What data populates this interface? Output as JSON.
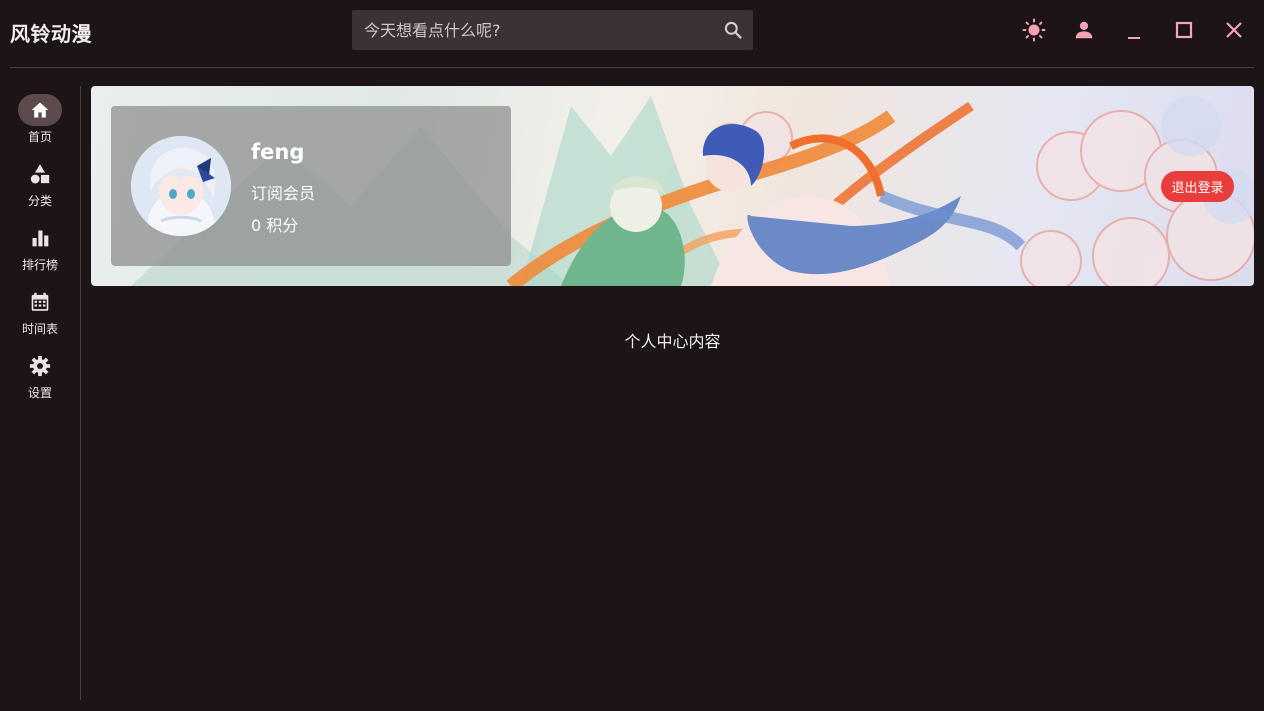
{
  "app": {
    "title": "风铃动漫"
  },
  "search": {
    "placeholder": "今天想看点什么呢?"
  },
  "window_controls": [
    "theme-toggle",
    "user",
    "minimize",
    "maximize",
    "close"
  ],
  "colors": {
    "background": "#1c1416",
    "accent_pink": "#f5a3b5",
    "logout_red": "#e83d3a",
    "active_nav": "#5c4a4d"
  },
  "sidebar": {
    "items": [
      {
        "label": "首页",
        "icon": "home-icon",
        "active": true
      },
      {
        "label": "分类",
        "icon": "category-shapes-icon",
        "active": false
      },
      {
        "label": "排行榜",
        "icon": "bar-chart-icon",
        "active": false
      },
      {
        "label": "时间表",
        "icon": "calendar-icon",
        "active": false
      },
      {
        "label": "设置",
        "icon": "gear-icon",
        "active": false
      }
    ]
  },
  "profile": {
    "username": "feng",
    "membership": "订阅会员",
    "points": "0 积分",
    "logout_label": "退出登录"
  },
  "main": {
    "content_text": "个人中心内容"
  }
}
